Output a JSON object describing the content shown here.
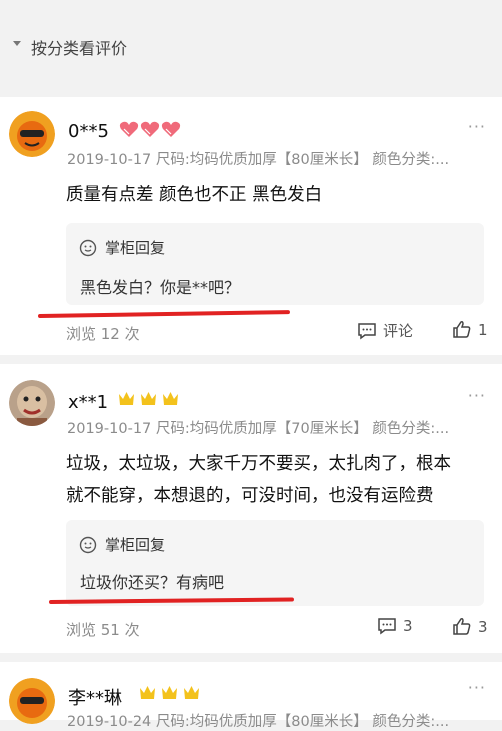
{
  "filter": {
    "label": "按分类看评价"
  },
  "reviews": [
    {
      "user": "0**5",
      "date": "2019-10-17",
      "spec": "尺码:均码优质加厚【80厘米长】 颜色分类:...",
      "content": "质量有点差  颜色也不正 黑色发白",
      "reply_title": "掌柜回复",
      "reply": "黑色发白？你是**吧？",
      "views": "浏览 12 次",
      "comment_label": "评论",
      "likes": "1"
    },
    {
      "user": "x**1",
      "date": "2019-10-17",
      "spec": "尺码:均码优质加厚【70厘米长】 颜色分类:...",
      "content_line1": "垃圾，太垃圾，大家千万不要买，太扎肉了，根本",
      "content_line2": "就不能穿，本想退的，可没时间，也没有运险费",
      "reply_title": "掌柜回复",
      "reply": "垃圾你还买？有病吧",
      "views": "浏览 51 次",
      "comments": "3",
      "likes": "3"
    },
    {
      "user": "李**琳",
      "date": "2019-10-24",
      "spec": "尺码:均码优质加厚【80厘米长】 颜色分类:..."
    }
  ],
  "colors": {
    "heart": "#f06a7a",
    "crown": "#f3c21c",
    "underline": "#e12222"
  }
}
